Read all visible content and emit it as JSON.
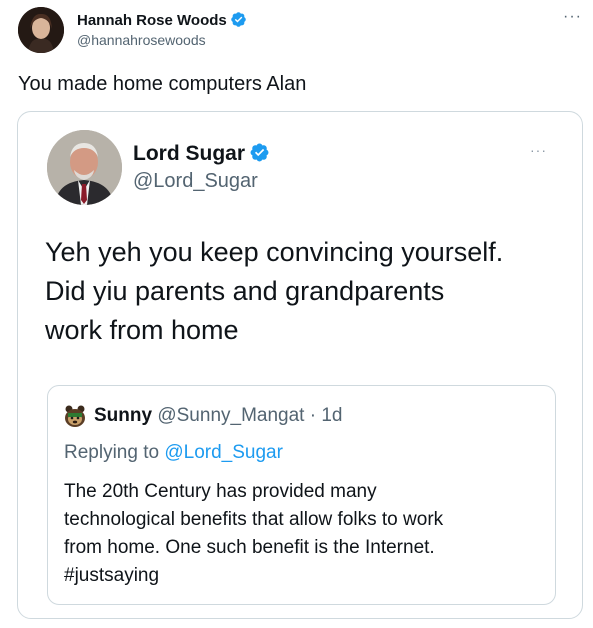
{
  "outer_tweet": {
    "author_name": "Hannah Rose Woods",
    "author_handle": "@hannahrosewoods",
    "more_label": "···",
    "text": "You made home computers Alan"
  },
  "quoted_tweet": {
    "author_name": "Lord Sugar",
    "author_handle": "@Lord_Sugar",
    "more_label": "···",
    "text_lines": [
      "Yeh yeh you keep convincing yourself.",
      "Did yiu parents and grandparents",
      "work from home"
    ]
  },
  "inner_tweet": {
    "author_name": "Sunny",
    "author_handle": "@Sunny_Mangat",
    "separator": " · ",
    "time": "1d",
    "replying_prefix": "Replying to ",
    "replying_to": "@Lord_Sugar",
    "text_lines": [
      "The 20th Century has provided many",
      "technological benefits that allow folks to work",
      "from home. One such benefit is the Internet.",
      "#justsaying"
    ]
  },
  "colors": {
    "verified": "#1d9bf0",
    "link": "#1d9bf0",
    "border": "#cfd9de",
    "secondary_text": "#536471"
  },
  "icons": [
    "verified-badge-icon",
    "more-options-icon",
    "avatar-image"
  ]
}
